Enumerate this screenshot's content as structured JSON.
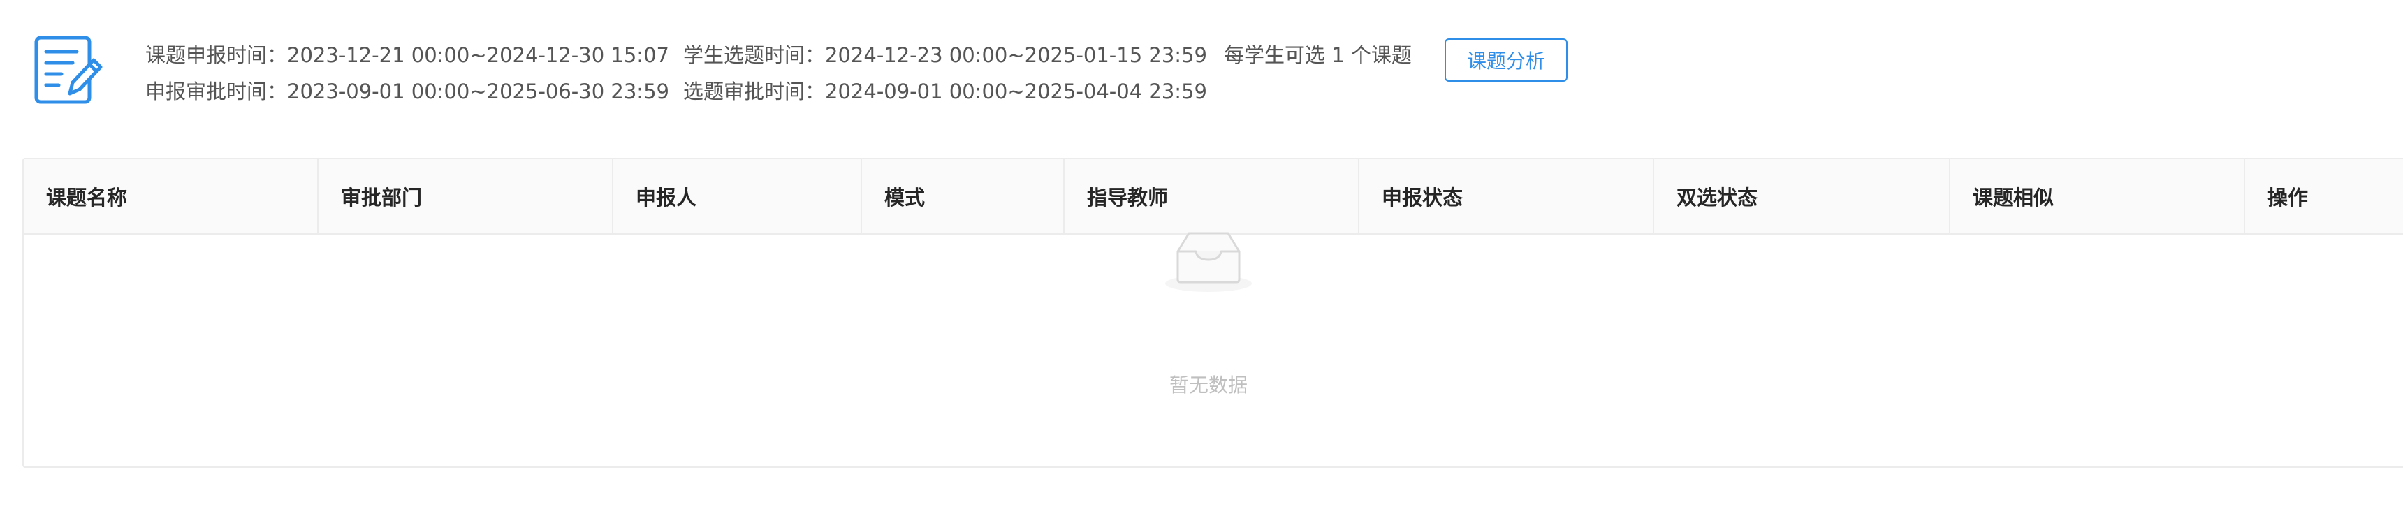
{
  "info": {
    "declare_time_label": "课题申报时间：",
    "declare_time_value": "2023-12-21 00:00~2024-12-30 15:07",
    "declare_approve_label": "申报审批时间：",
    "declare_approve_value": "2023-09-01 00:00~2025-06-30 23:59",
    "select_time_label": "学生选题时间：",
    "select_time_value": "2024-12-23 00:00~2025-01-15 23:59",
    "select_approve_label": "选题审批时间：",
    "select_approve_value": "2024-09-01 00:00~2025-04-04 23:59",
    "limit_text": "每学生可选 1 个课题"
  },
  "analyze_button": "课题分析",
  "table": {
    "columns": [
      "课题名称",
      "审批部门",
      "申报人",
      "模式",
      "指导教师",
      "申报状态",
      "双选状态",
      "课题相似",
      "操作"
    ],
    "empty_text": "暂无数据"
  },
  "colors": {
    "accent": "#2f8fe8",
    "header_bg": "#fafafa",
    "border": "#ececec"
  }
}
